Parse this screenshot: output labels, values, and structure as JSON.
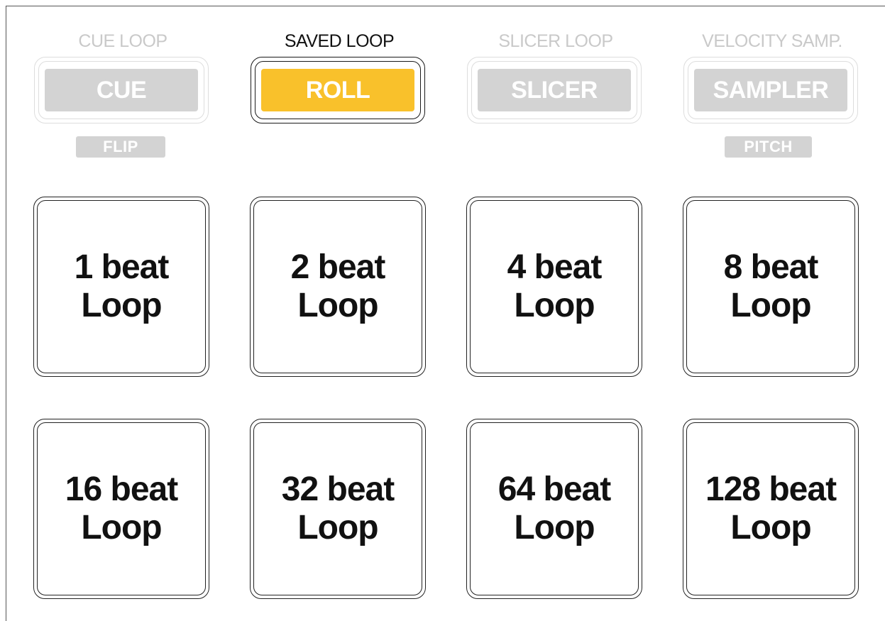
{
  "modes": [
    {
      "label": "CUE LOOP",
      "button": "CUE",
      "state": "inactive",
      "shift": "FLIP"
    },
    {
      "label": "SAVED LOOP",
      "button": "ROLL",
      "state": "active",
      "shift": ""
    },
    {
      "label": "SLICER LOOP",
      "button": "SLICER",
      "state": "inactive",
      "shift": ""
    },
    {
      "label": "VELOCITY SAMP.",
      "button": "SAMPLER",
      "state": "inactive",
      "shift": "PITCH"
    }
  ],
  "pads": [
    {
      "line1": "1 beat",
      "line2": "Loop"
    },
    {
      "line1": "2 beat",
      "line2": "Loop"
    },
    {
      "line1": "4 beat",
      "line2": "Loop"
    },
    {
      "line1": "8 beat",
      "line2": "Loop"
    },
    {
      "line1": "16 beat",
      "line2": "Loop"
    },
    {
      "line1": "32 beat",
      "line2": "Loop"
    },
    {
      "line1": "64 beat",
      "line2": "Loop"
    },
    {
      "line1": "128 beat",
      "line2": "Loop"
    }
  ],
  "colors": {
    "active_mode": "#f9c12b",
    "inactive_mode": "#d3d3d3",
    "inactive_text": "#c9c9c9"
  }
}
